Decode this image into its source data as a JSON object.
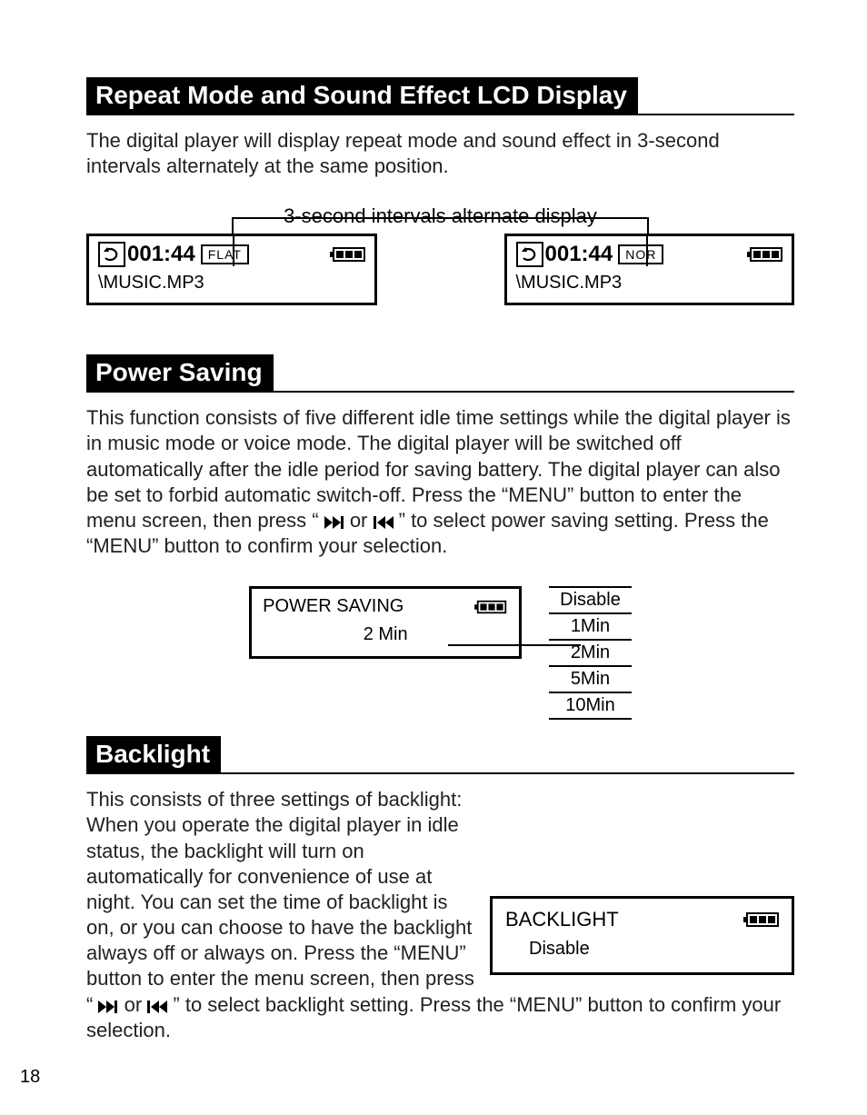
{
  "sections": {
    "repeat": {
      "title": "Repeat Mode and Sound Effect LCD Display",
      "intro": "The digital player will display repeat mode and sound effect in 3-second intervals alternately at the same position.",
      "caption": "3-second intervals alternate display",
      "lcd1": {
        "time": "001:44",
        "eq": "FLAT",
        "file": "\\MUSIC.MP3"
      },
      "lcd2": {
        "time": "001:44",
        "eq": "NOR",
        "file": "\\MUSIC.MP3"
      }
    },
    "power": {
      "title": "Power Saving",
      "intro_pre": "This function consists of five different idle time settings while the digital player is in music mode or voice mode. The digital player will be switched off automatically after the idle period for saving battery. The digital player can also be set to forbid automatic switch-off. Press the “MENU” button to enter the menu screen, then press “ ",
      "intro_mid": " or ",
      "intro_post": " ” to select power saving setting. Press the “MENU” button to confirm your selection.",
      "lcd": {
        "title": "POWER SAVING",
        "value": "2  Min"
      },
      "options": [
        "Disable",
        "1Min",
        "2Min",
        "5Min",
        "10Min"
      ]
    },
    "backlight": {
      "title": "Backlight",
      "intro_pre": "This consists of three settings of backlight: When you operate the digital player in idle status, the backlight will turn on automatically for convenience of use at night. You can set the time of backlight is on, or you can choose to have the backlight always off or always on. Press the “MENU” button to enter the menu screen, then press “ ",
      "intro_mid": " or ",
      "intro_post": " ” to select backlight setting. Press the “MENU” button to confirm your selection.",
      "lcd": {
        "title": "BACKLIGHT",
        "value": "Disable"
      }
    }
  },
  "page_number": "18"
}
